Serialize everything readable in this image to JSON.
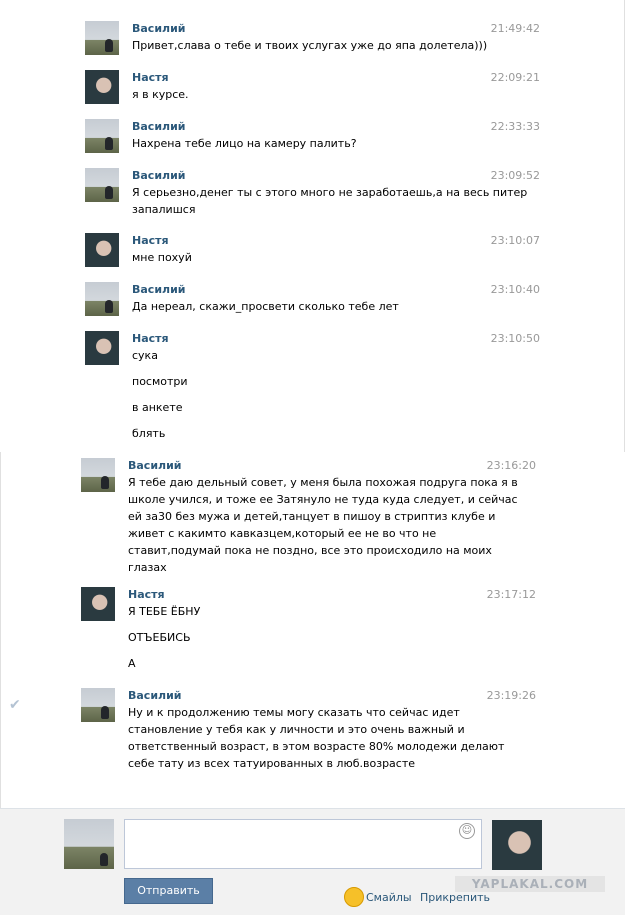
{
  "messages": [
    {
      "author": "Василий",
      "time": "21:49:42",
      "lines": [
        "Привет,слава о тебе и твоих услугах уже до япа долетела)))"
      ]
    },
    {
      "author": "Настя",
      "time": "22:09:21",
      "lines": [
        "я в курсе."
      ]
    },
    {
      "author": "Василий",
      "time": "22:33:33",
      "lines": [
        "Нахрена тебе лицо на камеру палить?"
      ]
    },
    {
      "author": "Василий",
      "time": "23:09:52",
      "lines": [
        "Я серьезно,денег ты с этого много не заработаешь,а на весь питер",
        "запалишся"
      ]
    },
    {
      "author": "Настя",
      "time": "23:10:07",
      "lines": [
        "мне похуй"
      ]
    },
    {
      "author": "Василий",
      "time": "23:10:40",
      "lines": [
        "Да нереал, скажи_просвети сколько тебе лет"
      ]
    },
    {
      "author": "Настя",
      "time": "23:10:50",
      "lines": [
        "сука",
        "посмотри",
        "в анкете",
        "блять"
      ]
    },
    {
      "author": "Василий",
      "time": "23:16:20",
      "lines": [
        "Я тебе даю дельный совет, у меня была похожая подруга пока я в",
        "школе учился, и тоже ее Затянуло не туда куда следует, и сейчас",
        "ей за30 без мужа и детей,танцует в пишоу в стриптиз клубе и",
        "живет с какимто кавказцем,который ее не во что не",
        "ставит,подумай пока не поздно, все это происходило на моих",
        "глазах"
      ]
    },
    {
      "author": "Настя",
      "time": "23:17:12",
      "lines": [
        "Я ТЕБЕ ЁБНУ",
        "ОТЪЕБИСЬ",
        "А"
      ]
    },
    {
      "author": "Василий",
      "time": "23:19:26",
      "lines": [
        "Ну и к продолжению темы могу сказать что сейчас идет",
        "становление у тебя как у личности и это очень важный и",
        "ответственный возраст, в этом возрасте 80% молодежи делают",
        "себе тату из всех татуированных в люб.возрасте"
      ]
    }
  ],
  "composer": {
    "send_label": "Отправить",
    "smiles_label": "Смайлы",
    "attach_label": "Прикрепить",
    "input_value": ""
  },
  "watermark": "YAPLAKAL.COM"
}
